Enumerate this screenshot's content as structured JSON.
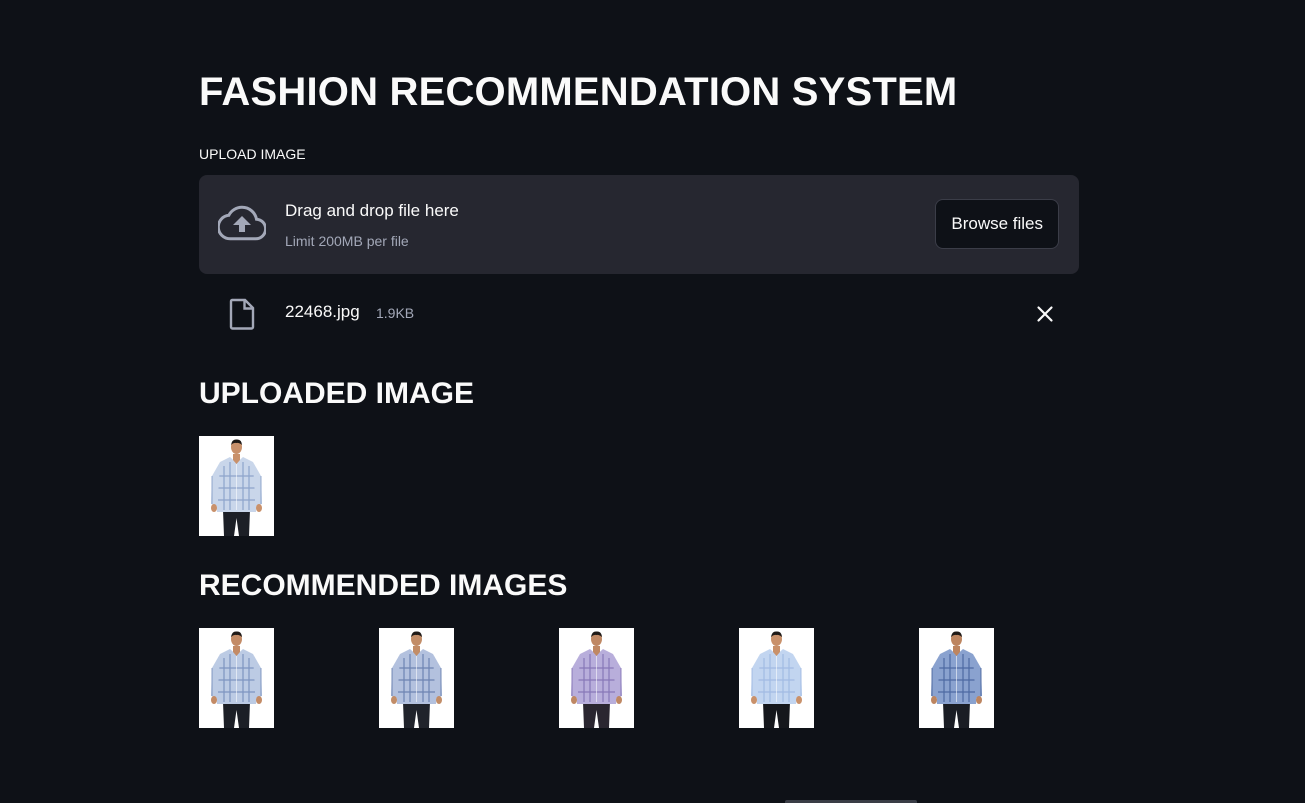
{
  "page": {
    "title": "FASHION RECOMMENDATION SYSTEM"
  },
  "uploader": {
    "label": "UPLOAD IMAGE",
    "drop_text": "Drag and drop file here",
    "limit_text": "Limit 200MB per file",
    "browse_label": "Browse files",
    "icon": "cloud-upload-icon"
  },
  "uploaded_file": {
    "name": "22468.jpg",
    "size": "1.9KB",
    "icon": "file-icon",
    "remove_icon": "close-icon"
  },
  "uploaded_section": {
    "heading": "UPLOADED IMAGE",
    "image": {
      "shirt": "#c9d6ea",
      "check": "#7f98c4",
      "pants": "#1c1f26",
      "skin": "#c9916b"
    }
  },
  "recommended_section": {
    "heading": "RECOMMENDED IMAGES",
    "images": [
      {
        "shirt": "#bccbe4",
        "check": "#6f88b8",
        "pants": "#1c1f26",
        "skin": "#c38b66"
      },
      {
        "shirt": "#b3c1de",
        "check": "#5c76a8",
        "pants": "#20232b",
        "skin": "#c28d68"
      },
      {
        "shirt": "#b8aedb",
        "check": "#7b6bb0",
        "pants": "#2a2630",
        "skin": "#bf8864"
      },
      {
        "shirt": "#c2d5f0",
        "check": "#9ab5e0",
        "pants": "#15171c",
        "skin": "#c9916b"
      },
      {
        "shirt": "#8aa2cf",
        "check": "#3f5c97",
        "pants": "#1a1d24",
        "skin": "#bd8560"
      }
    ]
  },
  "colors": {
    "background": "#0e1117",
    "dropzone": "#262730",
    "text": "#fafafa",
    "muted_text": "#a3a8b8"
  }
}
